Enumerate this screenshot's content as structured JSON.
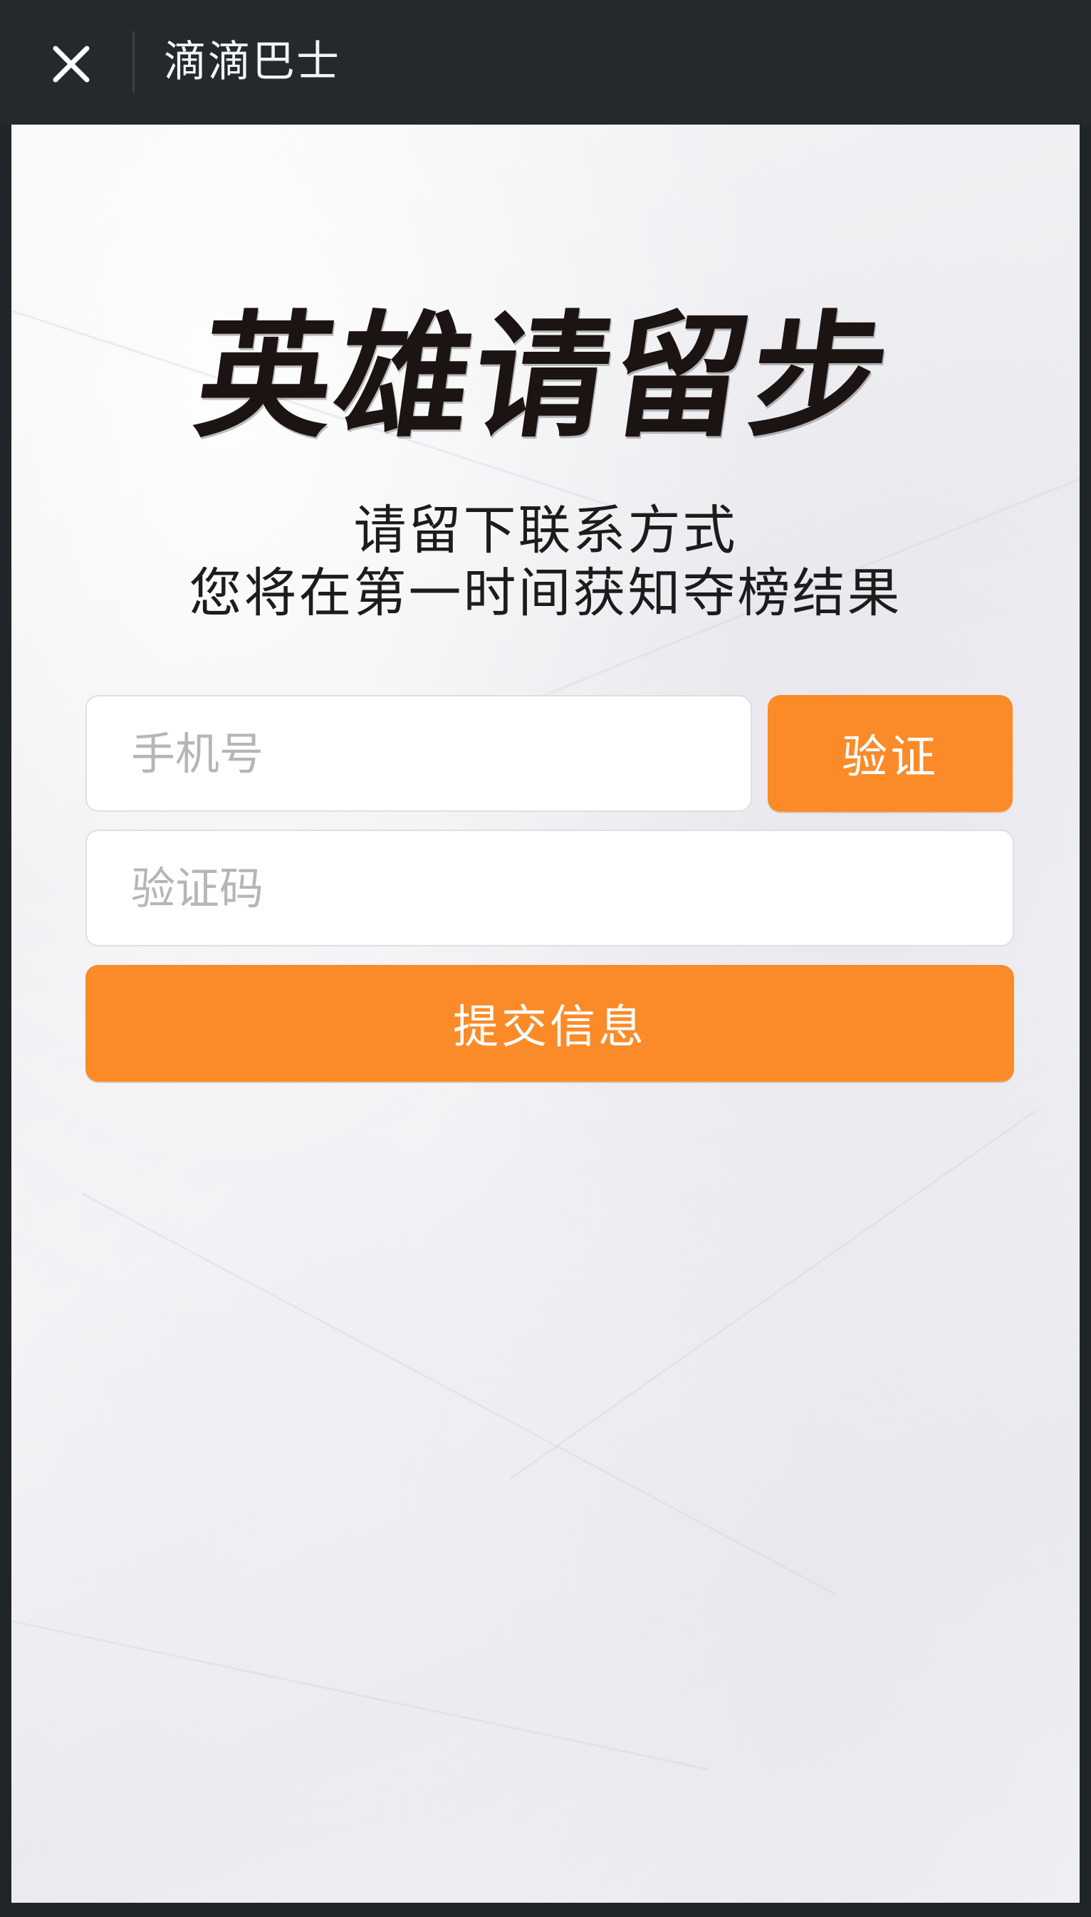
{
  "app": {
    "title": "滴滴巴士"
  },
  "header": {
    "close_icon": "close-icon"
  },
  "hero": {
    "headline": "英雄请留步",
    "subtitle_line1": "请留下联系方式",
    "subtitle_line2": "您将在第一时间获知夺榜结果"
  },
  "form": {
    "phone_placeholder": "手机号",
    "phone_value": "",
    "verify_label": "验证",
    "code_placeholder": "验证码",
    "code_value": "",
    "submit_label": "提交信息"
  },
  "colors": {
    "topbar": "#23292c",
    "accent": "#fb8b28",
    "text_dark": "#1b1413"
  }
}
